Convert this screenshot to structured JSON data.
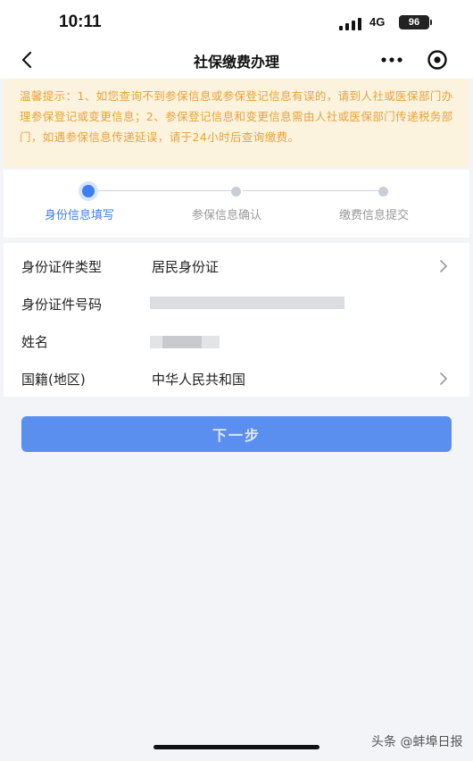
{
  "status_bar": {
    "time": "10:11",
    "network": "4G",
    "battery": "96",
    "icons": {
      "signal": "signal-bars-icon",
      "battery": "battery-icon"
    }
  },
  "nav": {
    "title": "社保缴费办理",
    "icons": {
      "back": "chevron-left-icon",
      "more": "more-dots-icon",
      "close": "close-miniprogram-icon"
    }
  },
  "notice": {
    "text": "温馨提示：1、如您查询不到参保信息或参保登记信息有误的，请到人社或医保部门办理参保登记或变更信息；2、参保登记信息和变更信息需由人社或医保部门传递税务部门，如遇参保信息传递延误，请于24小时后查询缴费。"
  },
  "steps": [
    {
      "label": "身份信息填写",
      "active": true
    },
    {
      "label": "参保信息确认",
      "active": false
    },
    {
      "label": "缴费信息提交",
      "active": false
    }
  ],
  "form": {
    "id_type": {
      "label": "身份证件类型",
      "value": "居民身份证"
    },
    "id_number": {
      "label": "身份证件号码",
      "value": ""
    },
    "name": {
      "label": "姓名",
      "value": ""
    },
    "nationality": {
      "label": "国籍(地区)",
      "value": "中华人民共和国"
    }
  },
  "button": {
    "next_label": "下一步"
  },
  "colors": {
    "accent": "#3d7ef0",
    "button": "#5a8ff0",
    "notice_bg": "#fcf3df",
    "notice_text": "#e6a23c"
  },
  "watermark": "头条 @蚌埠日报"
}
